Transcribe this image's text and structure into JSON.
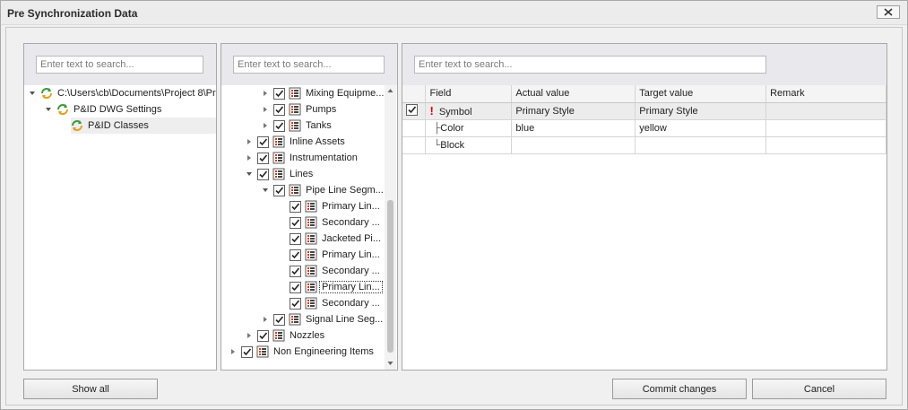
{
  "window": {
    "title": "Pre Synchronization Data"
  },
  "left_panel": {
    "search_placeholder": "Enter text to search...",
    "items": [
      {
        "label": "C:\\Users\\cb\\Documents\\Project 8\\Pr",
        "icon": "sync-icon"
      },
      {
        "label": "P&ID DWG Settings",
        "icon": "sync-icon"
      },
      {
        "label": "P&ID Classes",
        "icon": "sync-icon"
      }
    ]
  },
  "middle_panel": {
    "search_placeholder": "Enter text to search...",
    "items": [
      {
        "label": "Mixing Equipme...",
        "checked": true
      },
      {
        "label": "Pumps",
        "checked": true
      },
      {
        "label": "Tanks",
        "checked": true
      },
      {
        "label": "Inline Assets",
        "checked": true
      },
      {
        "label": "Instrumentation",
        "checked": true
      },
      {
        "label": "Lines",
        "checked": true
      },
      {
        "label": "Pipe Line Segm...",
        "checked": true
      },
      {
        "label": "Primary Lin...",
        "checked": true
      },
      {
        "label": "Secondary ...",
        "checked": true
      },
      {
        "label": "Jacketed Pi...",
        "checked": true
      },
      {
        "label": "Primary Lin...",
        "checked": true
      },
      {
        "label": "Secondary ...",
        "checked": true
      },
      {
        "label": "Primary Lin...",
        "checked": true
      },
      {
        "label": "Secondary ...",
        "checked": true
      },
      {
        "label": "Signal Line Seg...",
        "checked": true
      },
      {
        "label": "Nozzles",
        "checked": true
      },
      {
        "label": "Non Engineering Items",
        "checked": true
      }
    ]
  },
  "right_panel": {
    "search_placeholder": "Enter text to search...",
    "columns": [
      "Field",
      "Actual value",
      "Target value",
      "Remark"
    ],
    "rows": [
      {
        "field": "Symbol",
        "prefix": "",
        "actual": "Primary Style",
        "target": "Primary Style",
        "remark": "",
        "checked": true,
        "warning": "!"
      },
      {
        "field": "Color",
        "prefix": "├",
        "actual": "blue",
        "target": "yellow",
        "remark": ""
      },
      {
        "field": "Block",
        "prefix": "└",
        "actual": "",
        "target": "",
        "remark": ""
      }
    ]
  },
  "buttons": {
    "show_all": "Show all",
    "commit": "Commit changes",
    "cancel": "Cancel"
  },
  "colors": {
    "warning": "#d0021b",
    "list_icon_accent": "#d83b01"
  }
}
